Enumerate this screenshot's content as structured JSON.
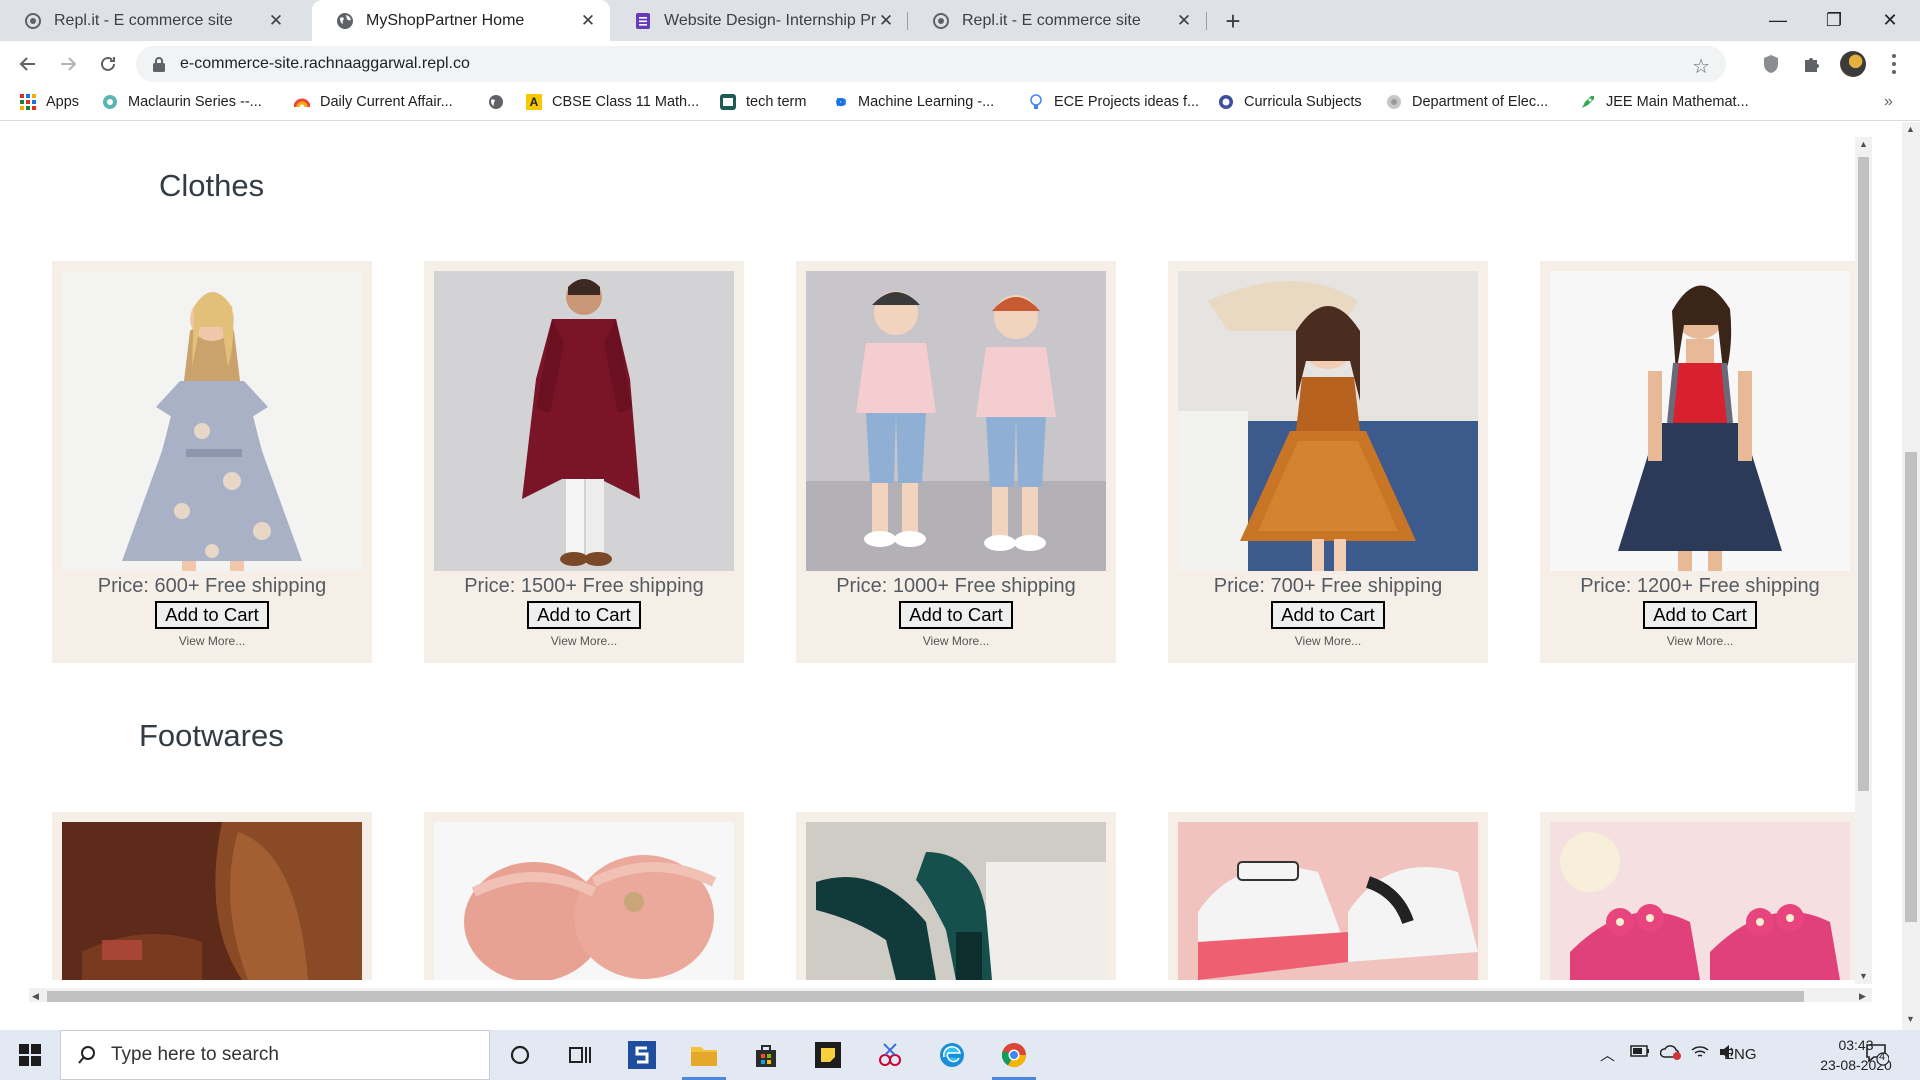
{
  "tabs": [
    {
      "title": "Repl.it - E commerce site",
      "icon": "replit-icon"
    },
    {
      "title": "MyShopPartner Home",
      "icon": "globe-icon"
    },
    {
      "title": "Website Design- Internship Proje",
      "icon": "forms-icon"
    },
    {
      "title": "Repl.it - E commerce site",
      "icon": "replit-icon"
    }
  ],
  "new_tab": "+",
  "window": {
    "minimize": "—",
    "maximize": "❐",
    "close": "✕"
  },
  "address": {
    "url": "e-commerce-site.rachnaaggarwal.repl.co"
  },
  "bookmarks": [
    {
      "label": "Apps"
    },
    {
      "label": "Maclaurin Series --..."
    },
    {
      "label": "Daily Current Affair..."
    },
    {
      "label": ""
    },
    {
      "label": "CBSE Class 11 Math..."
    },
    {
      "label": "tech term"
    },
    {
      "label": "Machine Learning -..."
    },
    {
      "label": "ECE Projects ideas f..."
    },
    {
      "label": "Curricula Subjects"
    },
    {
      "label": "Department of Elec..."
    },
    {
      "label": "JEE Main Mathemat..."
    }
  ],
  "bookmarks_more": "»",
  "sections": {
    "clothes": {
      "title": "Clothes",
      "products": [
        {
          "price": "Price: 600+ Free shipping",
          "cart": "Add to Cart",
          "more": "View More..."
        },
        {
          "price": "Price: 1500+ Free shipping",
          "cart": "Add to Cart",
          "more": "View More..."
        },
        {
          "price": "Price: 1000+ Free shipping",
          "cart": "Add to Cart",
          "more": "View More..."
        },
        {
          "price": "Price: 700+ Free shipping",
          "cart": "Add to Cart",
          "more": "View More..."
        },
        {
          "price": "Price: 1200+ Free shipping",
          "cart": "Add to Cart",
          "more": "View More..."
        }
      ]
    },
    "footwares": {
      "title": "Footwares"
    }
  },
  "taskbar": {
    "search_placeholder": "Type here to search",
    "lang": "ENG",
    "time": "03:43",
    "date": "23-08-2020",
    "notifications": "4"
  }
}
